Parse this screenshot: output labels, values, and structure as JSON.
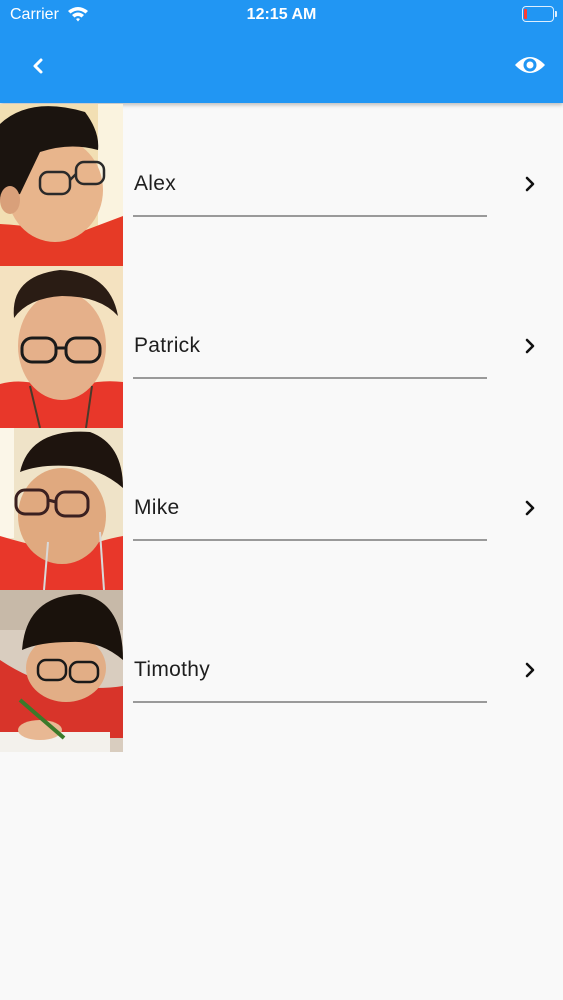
{
  "status_bar": {
    "carrier": "Carrier",
    "time": "12:15 AM"
  },
  "app_bar": {
    "back_icon": "chevron-left-icon",
    "action_icon": "eye-icon",
    "color": "#2196f3"
  },
  "people": [
    {
      "name": "Alex"
    },
    {
      "name": "Patrick"
    },
    {
      "name": "Mike"
    },
    {
      "name": "Timothy"
    }
  ]
}
